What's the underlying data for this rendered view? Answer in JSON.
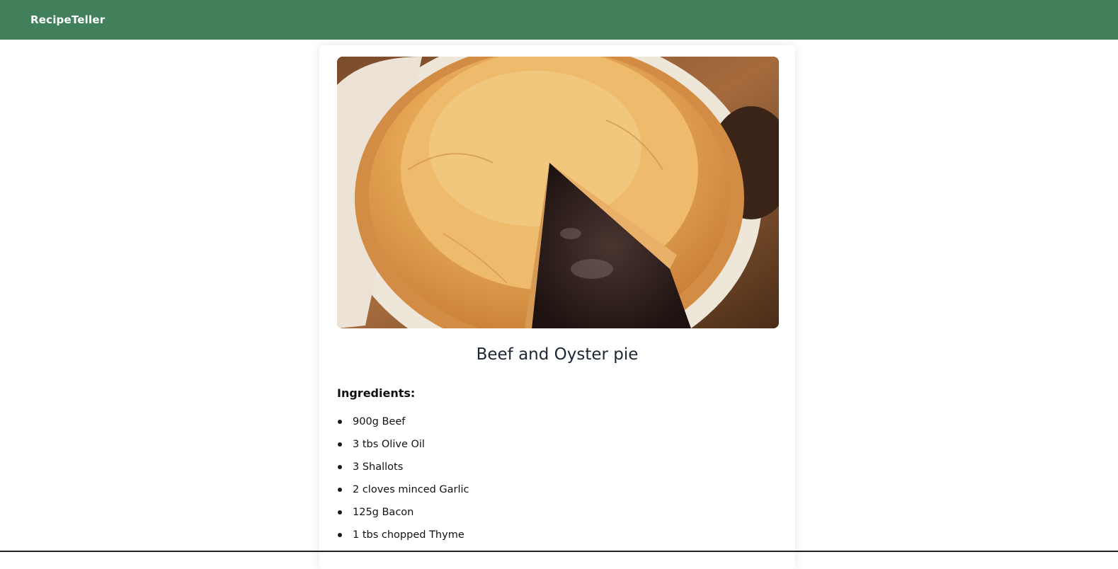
{
  "navbar": {
    "brand": "RecipeTeller",
    "color": "#41805b"
  },
  "recipe": {
    "image_icon": "recipe-photo",
    "title": "Beef and Oyster pie",
    "ingredients_label": "Ingredients:",
    "ingredients": [
      "900g Beef",
      "3 tbs Olive Oil",
      "3 Shallots",
      "2 cloves minced Garlic",
      "125g Bacon",
      "1 tbs chopped Thyme"
    ]
  }
}
